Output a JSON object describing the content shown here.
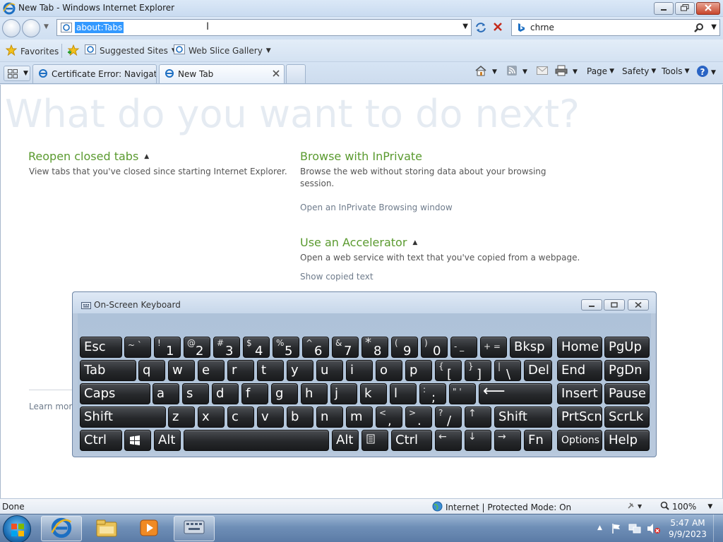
{
  "window": {
    "title": "New Tab - Windows Internet Explorer"
  },
  "navbar": {
    "address_value": "about:Tabs",
    "search_value": "chrne"
  },
  "favorites_bar": {
    "favorites_label": "Favorites",
    "items": [
      {
        "label": "Suggested Sites"
      },
      {
        "label": "Web Slice Gallery"
      }
    ]
  },
  "tabs": [
    {
      "label": "Certificate Error: Navigatio..."
    },
    {
      "label": "New Tab"
    }
  ],
  "command_bar": {
    "page_label": "Page",
    "safety_label": "Safety",
    "tools_label": "Tools"
  },
  "content": {
    "heading": "What do you want to do next?",
    "reopen": {
      "title": "Reopen closed tabs",
      "desc": "View tabs that you've closed since starting Internet Explorer."
    },
    "inprivate": {
      "title": "Browse with InPrivate",
      "desc_line1": "Browse the web without storing data about your browsing",
      "desc_line2": "session.",
      "link": "Open an InPrivate Browsing window"
    },
    "accelerator": {
      "title": "Use an Accelerator",
      "desc": "Open a web service with text that you've copied from a webpage.",
      "link": "Show copied text"
    },
    "learn_more": "Learn more"
  },
  "statusbar": {
    "status": "Done",
    "zone": "Internet | Protected Mode: On",
    "zoom": "100%"
  },
  "taskbar": {
    "time": "5:47 AM",
    "date": "9/9/2023"
  },
  "osk": {
    "title": "On-Screen Keyboard",
    "keys": {
      "esc": "Esc",
      "bksp": "Bksp",
      "home": "Home",
      "pgup": "PgUp",
      "tab": "Tab",
      "del": "Del",
      "end": "End",
      "pgdn": "PgDn",
      "caps": "Caps",
      "insert": "Insert",
      "pause": "Pause",
      "shift": "Shift",
      "prtscn": "PrtScn",
      "scrlk": "ScrLk",
      "ctrl": "Ctrl",
      "alt": "Alt",
      "fn": "Fn",
      "options": "Options",
      "help": "Help",
      "q": "q",
      "w": "w",
      "e": "e",
      "r": "r",
      "t": "t",
      "y": "y",
      "u": "u",
      "i": "i",
      "o": "o",
      "p": "p",
      "a": "a",
      "s": "s",
      "d": "d",
      "f": "f",
      "g": "g",
      "h": "h",
      "j": "j",
      "k": "k",
      "l": "l",
      "z": "z",
      "x": "x",
      "c": "c",
      "v": "v",
      "b": "b",
      "n": "n",
      "m": "m",
      "d1": "1",
      "d2": "2",
      "d3": "3",
      "d4": "4",
      "d5": "5",
      "d6": "6",
      "d7": "7",
      "d8": "8",
      "d9": "9",
      "d0": "0",
      "s1": "!",
      "s2": "@",
      "s3": "#",
      "s4": "$",
      "s5": "%",
      "s6": "^",
      "s7": "&",
      "s8": "(",
      "s9": ")",
      "tilde": "~ `",
      "minus": "- _",
      "plus": "+ =",
      "brace_open_top": "{",
      "brace_open_bot": "[",
      "brace_close_top": "}",
      "brace_close_bot": "]",
      "pipe_top": "|",
      "pipe_bot": "\\",
      "colon_top": ":",
      "colon_bot": ";",
      "quote": "\" '",
      "lt_top": "<",
      "lt_bot": ",",
      "gt_top": ">",
      "gt_bot": ".",
      "q_top": "?",
      "q_bot": "/",
      "up": "↑",
      "left": "←",
      "down": "↓",
      "right": "→",
      "enter": "⟵"
    }
  }
}
